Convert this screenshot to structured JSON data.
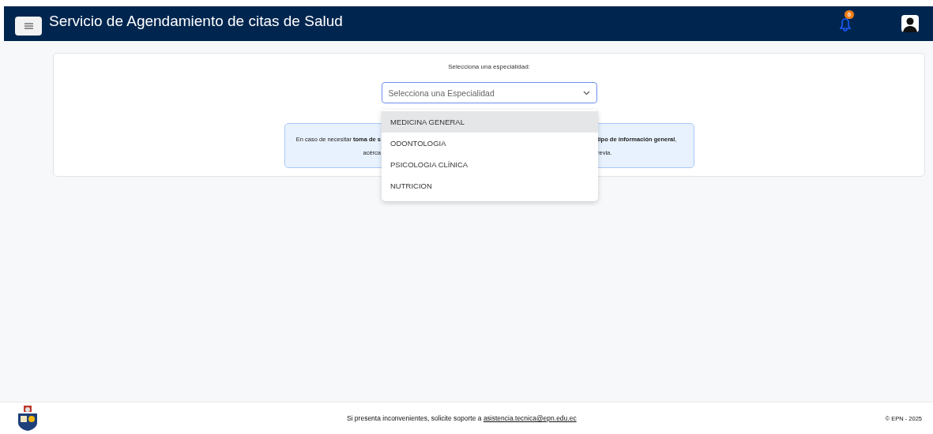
{
  "header": {
    "title": "Servicio de Agendamiento de citas de Salud",
    "notification_count": "0"
  },
  "form": {
    "label": "Selecciona una especialidad:",
    "select": {
      "placeholder": "Selecciona una Especialidad",
      "expanded": true
    },
    "options": [
      {
        "label": "MEDICINA GENERAL",
        "selected": true
      },
      {
        "label": "ODONTOLOGIA",
        "selected": false
      },
      {
        "label": "PSICOLOGIA CLÍNICA",
        "selected": false
      },
      {
        "label": "NUTRICION",
        "selected": false
      }
    ],
    "info": {
      "left_lines": [
        "En caso de necesitar **toma de s**",
        "acérca"
      ],
      "right_lines": [
        "**tipo de información general**,",
        "revia."
      ]
    }
  },
  "footer": {
    "text": "Si presenta inconvenientes, solicite soporte a",
    "link": "asistencia.tecnica@epn.edu.ec",
    "copyright": "© EPN - 2025"
  }
}
